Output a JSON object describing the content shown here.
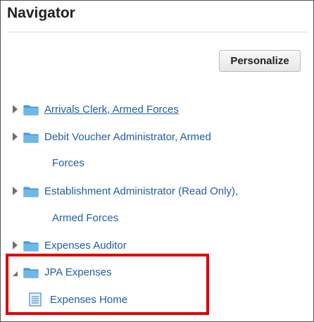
{
  "navigator": {
    "title": "Navigator",
    "personalize_label": "Personalize",
    "items": [
      {
        "line1": "Arrivals Clerk, Armed Forces",
        "line2": "",
        "expanded": false,
        "icon": "folder-icon"
      },
      {
        "line1": "Debit Voucher Administrator, Armed",
        "line2": "Forces",
        "expanded": false,
        "icon": "folder-icon"
      },
      {
        "line1": "Establishment Administrator (Read Only),",
        "line2": "Armed Forces",
        "expanded": false,
        "icon": "folder-icon"
      },
      {
        "line1": "Expenses Auditor",
        "line2": "",
        "expanded": false,
        "icon": "folder-icon"
      },
      {
        "line1": "JPA Expenses",
        "line2": "",
        "expanded": true,
        "icon": "folder-icon"
      }
    ],
    "child": {
      "label": "Expenses Home",
      "icon": "page-icon"
    }
  },
  "colors": {
    "link": "#1f5fa5",
    "highlight": "#e00000",
    "folder": "#4aa3df"
  }
}
